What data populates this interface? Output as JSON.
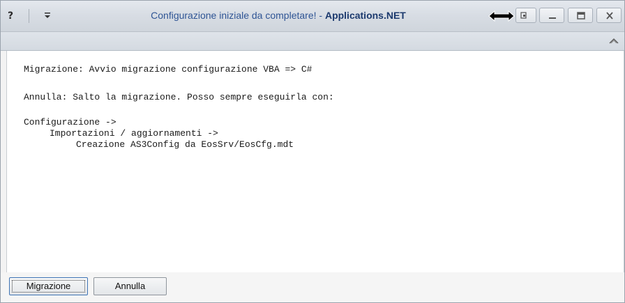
{
  "window": {
    "title_prefix": "Configurazione iniziale da completare! - ",
    "app_name": "Applications.NET",
    "help_label": "?"
  },
  "message": {
    "line1": "Migrazione: Avvio migrazione configurazione VBA => C#",
    "line2": "Annulla: Salto la migrazione. Posso sempre eseguirla con:",
    "line3": "Configurazione ->",
    "line4": "Importazioni / aggiornamenti ->",
    "line5": "Creazione AS3Config da EosSrv/EosCfg.mdt"
  },
  "buttons": {
    "migrazione": "Migrazione",
    "annulla": "Annulla"
  },
  "icons": {
    "help": "help-icon",
    "customize": "customize-qat-icon",
    "resize": "horizontal-resize-cursor-icon",
    "restore": "restore-down-icon",
    "minimize": "minimize-icon",
    "maximize": "maximize-icon",
    "close": "close-icon",
    "ribbon": "collapse-ribbon-icon"
  }
}
